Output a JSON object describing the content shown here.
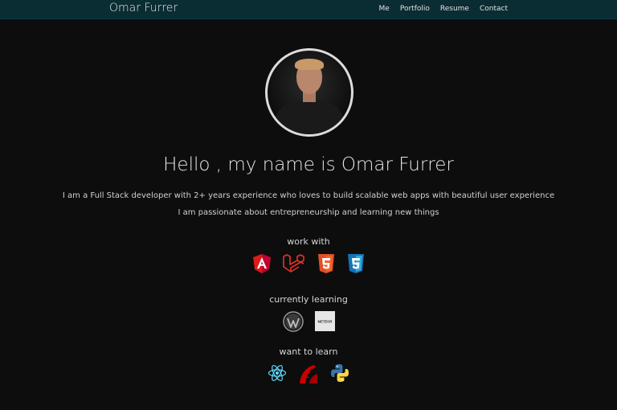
{
  "nav": {
    "brand": "Omar Furrer",
    "links": [
      "Me",
      "Portfolio",
      "Resume",
      "Contact"
    ]
  },
  "hero": {
    "heading": "Hello , my name is Omar Furrer",
    "bio_line1": "I am a Full Stack developer with 2+ years experience who loves to build scalable web apps with beautiful user experience",
    "bio_line2": "I am passionate about entrepreneurship and learning new things"
  },
  "sections": {
    "work_with": {
      "title": "work with",
      "icons": [
        "angular-icon",
        "laravel-icon",
        "html5-icon",
        "css3-icon"
      ]
    },
    "currently_learning": {
      "title": "currently learning",
      "icons": [
        "wordpress-icon",
        "meteor-icon"
      ],
      "meteor_label": "METEOR"
    },
    "want_to_learn": {
      "title": "want to learn",
      "icons": [
        "react-icon",
        "rails-icon",
        "python-icon"
      ]
    }
  },
  "colors": {
    "navbar": "#0a2d33",
    "background": "#0d0d0d",
    "angular": "#dd1b16",
    "html5": "#e44d26",
    "css3": "#1572b6",
    "react": "#61dafb",
    "python_blue": "#3776ab",
    "python_yellow": "#ffd43b"
  }
}
